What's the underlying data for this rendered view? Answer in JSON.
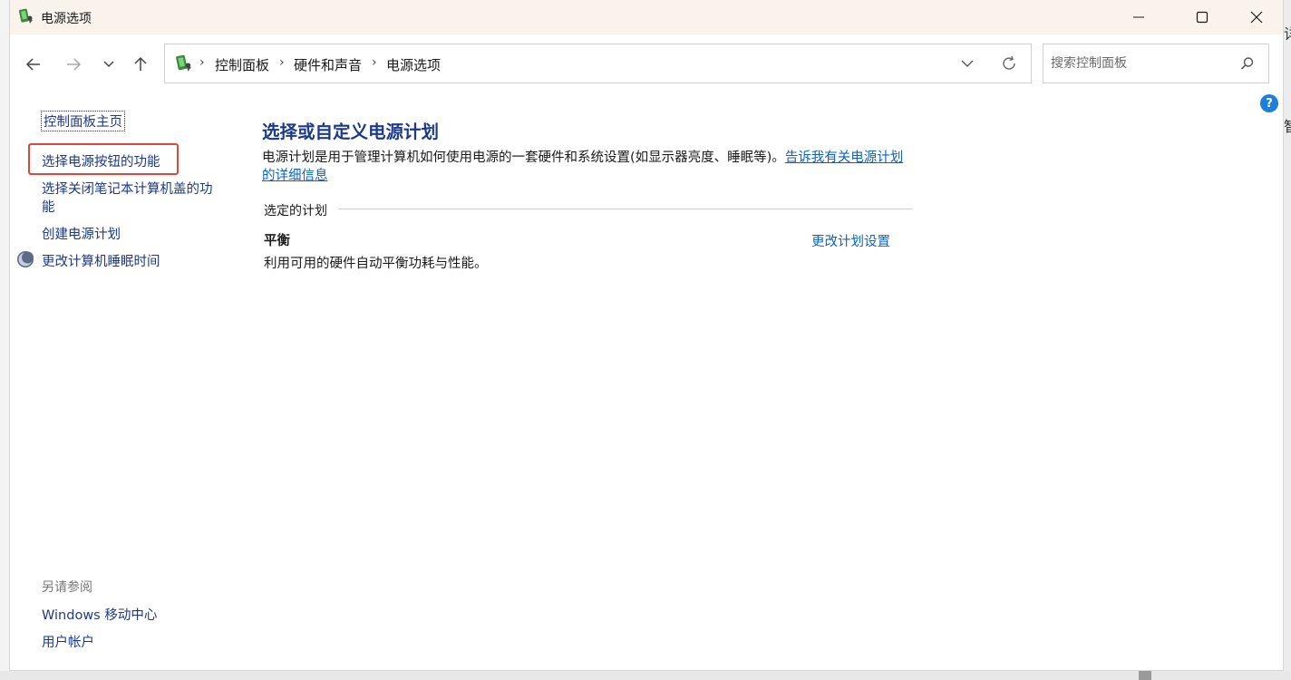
{
  "window": {
    "title": "电源选项",
    "minimize_icon": "minimize-icon",
    "maximize_icon": "maximize-icon",
    "close_icon": "close-icon"
  },
  "nav": {
    "back_icon": "back-arrow-icon",
    "forward_icon": "forward-arrow-icon",
    "recent_icon": "chevron-down-icon",
    "up_icon": "up-arrow-icon"
  },
  "address": {
    "crumbs": [
      "控制面板",
      "硬件和声音",
      "电源选项"
    ],
    "separator": "›"
  },
  "search": {
    "placeholder": "搜索控制面板",
    "value": ""
  },
  "sidebar": {
    "home": "控制面板主页",
    "items": [
      "选择电源按钮的功能",
      "选择关闭笔记本计算机盖的功",
      "能",
      "创建电源计划",
      "更改计算机睡眠时间"
    ],
    "see_also_title": "另请参阅",
    "see_also": [
      "Windows 移动中心",
      "用户帐户"
    ]
  },
  "main": {
    "title": "选择或自定义电源计划",
    "description": "电源计划是用于管理计算机如何使用电源的一套硬件和系统设置(如显示器亮度、睡眠等)。",
    "learn_more": "告诉我有关电源计划的详细信息",
    "section_label": "选定的计划",
    "plan": {
      "name": "平衡",
      "description": "利用可用的硬件自动平衡功耗与性能。",
      "change_link": "更改计划设置"
    }
  },
  "background": {
    "glyphs": [
      "详",
      "智"
    ]
  },
  "colors": {
    "link": "#1c3a8a",
    "hyperlink": "#0b63c6",
    "titlebar": "#f9f3ec",
    "highlight": "#e0463a",
    "help": "#1f7fd8"
  }
}
